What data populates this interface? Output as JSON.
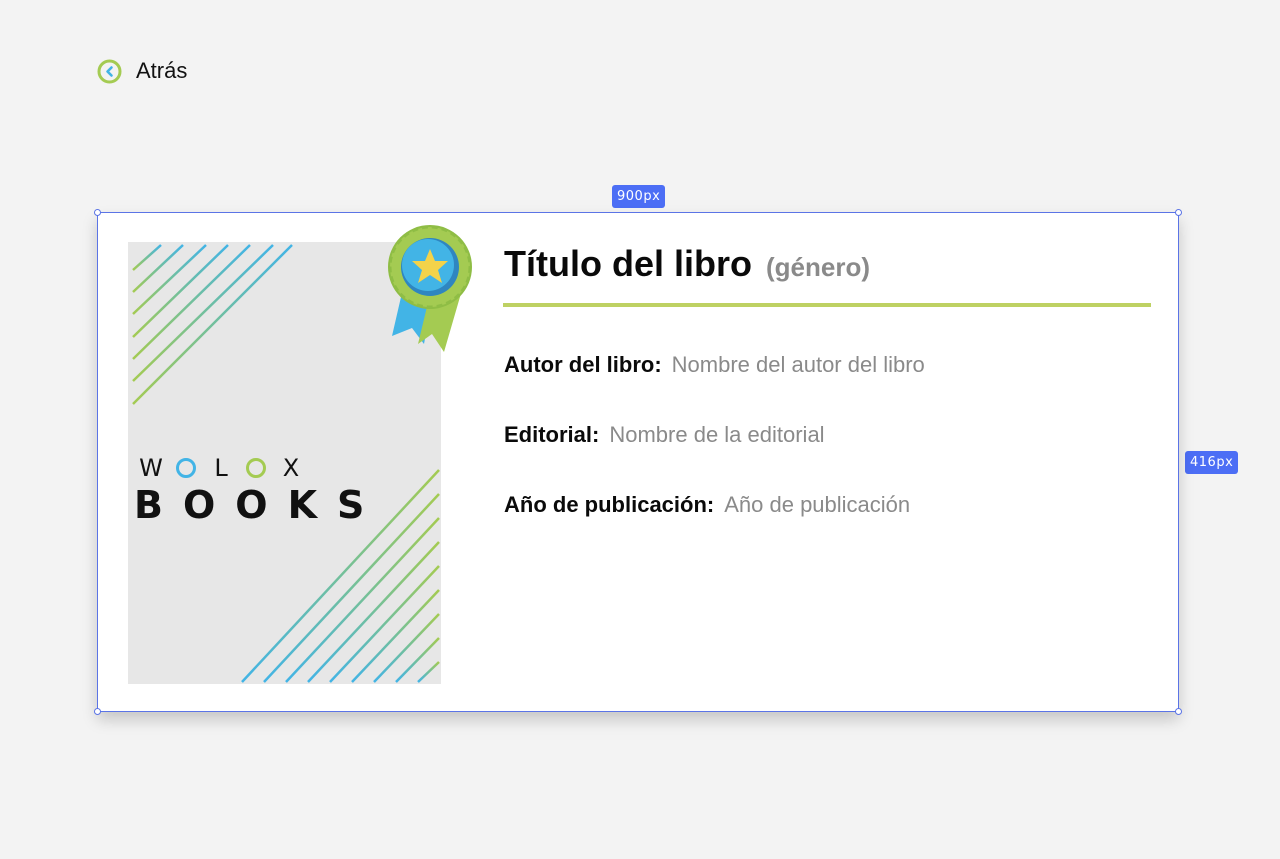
{
  "back": {
    "label": "Atrás",
    "icon": "chevron-left-circle-icon"
  },
  "dimensions": {
    "width_label": "900px",
    "height_label": "416px"
  },
  "cover": {
    "brand_top": [
      "W",
      "O",
      "L",
      "O",
      "X"
    ],
    "brand_bottom": "BOOKS",
    "badge_icon": "award-ribbon-icon"
  },
  "book": {
    "title": "Título del libro",
    "genre": "(género)",
    "fields": {
      "author": {
        "label": "Autor del libro:",
        "value": "Nombre del autor del libro"
      },
      "editorial": {
        "label": "Editorial:",
        "value": "Nombre de la editorial"
      },
      "year": {
        "label": "Año de publicación:",
        "value": "Año de publicación"
      }
    }
  },
  "colors": {
    "accent_green": "#bed163",
    "accent_blue": "#42b4e6",
    "selection_blue": "#4c6ef5"
  }
}
